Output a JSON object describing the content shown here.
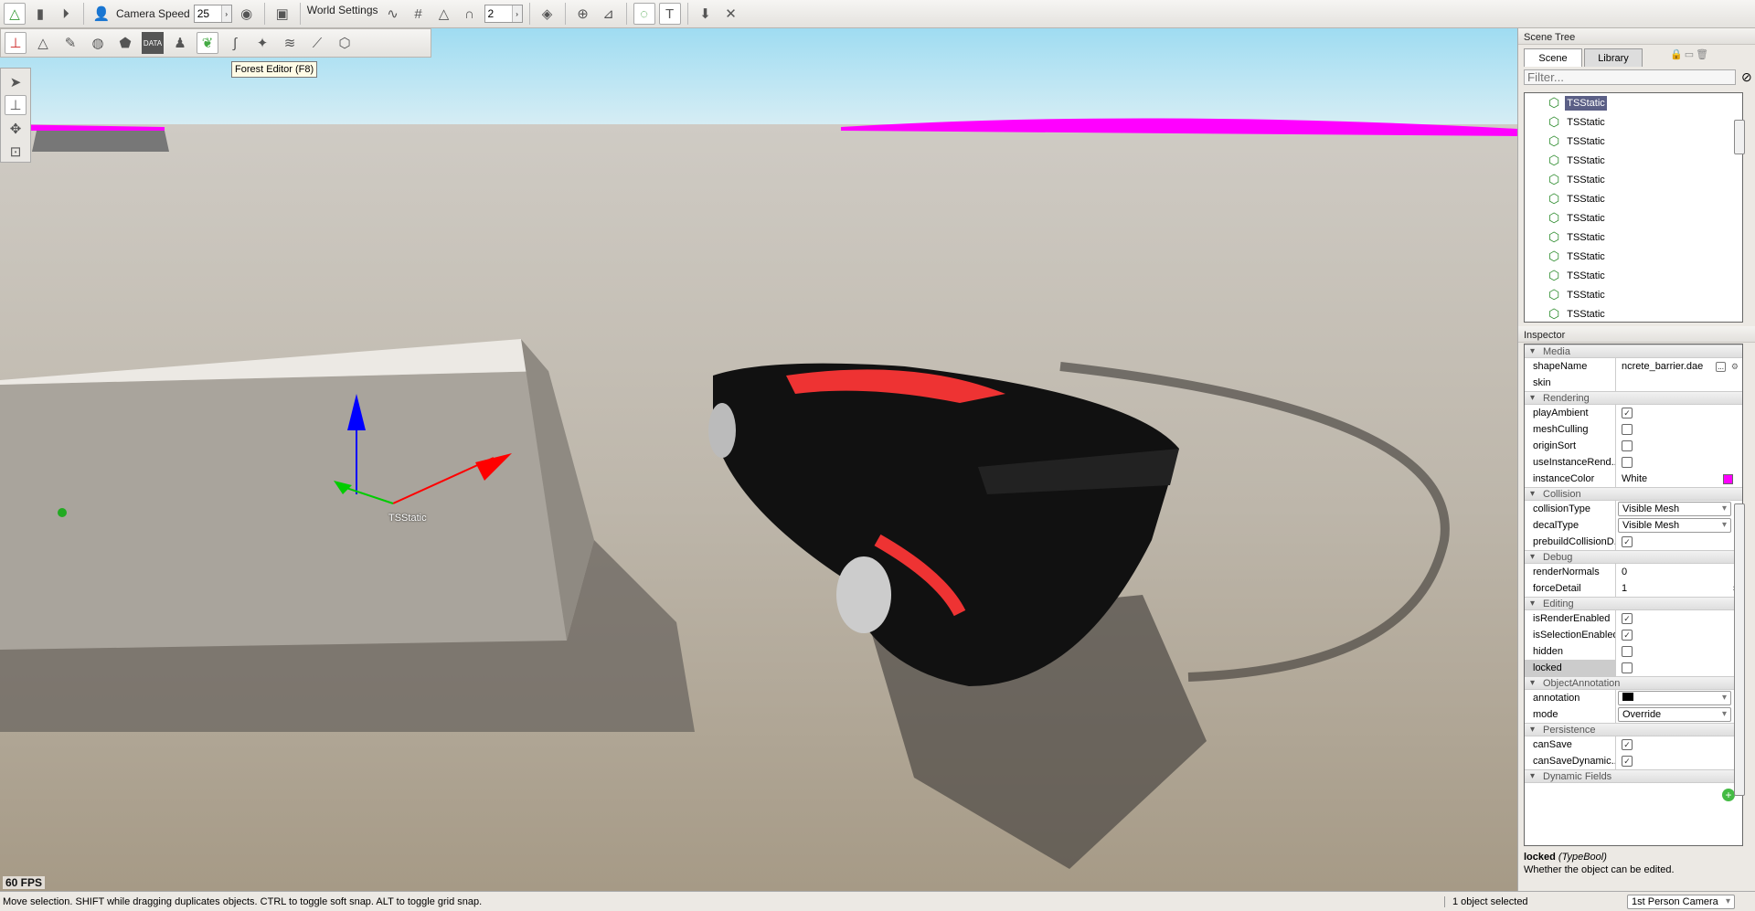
{
  "toolbar": {
    "camera_speed_label": "Camera Speed",
    "camera_speed": "25",
    "world_settings": "World Settings",
    "snap_value": "2"
  },
  "tooltip": "Forest Editor (F8)",
  "viewport": {
    "object_label": "TSStatic",
    "fps": "60 FPS"
  },
  "scene_tree": {
    "title": "Scene Tree",
    "tabs": [
      "Scene",
      "Library"
    ],
    "filter_placeholder": "Filter...",
    "items": [
      "TSStatic",
      "TSStatic",
      "TSStatic",
      "TSStatic",
      "TSStatic",
      "TSStatic",
      "TSStatic",
      "TSStatic",
      "TSStatic",
      "TSStatic",
      "TSStatic",
      "TSStatic"
    ]
  },
  "inspector": {
    "title": "Inspector",
    "sections": [
      {
        "name": "Media",
        "rows": [
          {
            "k": "shapeName",
            "v": "ncrete_barrier.dae",
            "type": "text"
          },
          {
            "k": "skin",
            "v": "",
            "type": "text"
          }
        ]
      },
      {
        "name": "Rendering",
        "rows": [
          {
            "k": "playAmbient",
            "type": "check",
            "checked": true
          },
          {
            "k": "meshCulling",
            "type": "check",
            "checked": false
          },
          {
            "k": "originSort",
            "type": "check",
            "checked": false
          },
          {
            "k": "useInstanceRend...",
            "type": "check",
            "checked": false
          },
          {
            "k": "instanceColor",
            "v": "White",
            "type": "color",
            "color": "#ff00ff"
          }
        ]
      },
      {
        "name": "Collision",
        "rows": [
          {
            "k": "collisionType",
            "v": "Visible Mesh",
            "type": "dropdown"
          },
          {
            "k": "decalType",
            "v": "Visible Mesh",
            "type": "dropdown"
          },
          {
            "k": "prebuildCollisionD...",
            "type": "check",
            "checked": true
          }
        ]
      },
      {
        "name": "Debug",
        "rows": [
          {
            "k": "renderNormals",
            "v": "0",
            "type": "text"
          },
          {
            "k": "forceDetail",
            "v": "1",
            "type": "spinner"
          }
        ]
      },
      {
        "name": "Editing",
        "rows": [
          {
            "k": "isRenderEnabled",
            "type": "check",
            "checked": true
          },
          {
            "k": "isSelectionEnabled",
            "type": "check",
            "checked": true
          },
          {
            "k": "hidden",
            "type": "check",
            "checked": false
          },
          {
            "k": "locked",
            "type": "check",
            "checked": false,
            "highlight": true
          }
        ]
      },
      {
        "name": "ObjectAnnotation",
        "rows": [
          {
            "k": "annotation",
            "v": "",
            "type": "dropdown",
            "swatch": "#000000"
          },
          {
            "k": "mode",
            "v": "Override",
            "type": "dropdown"
          }
        ]
      },
      {
        "name": "Persistence",
        "rows": [
          {
            "k": "canSave",
            "type": "check",
            "checked": true
          },
          {
            "k": "canSaveDynamic...",
            "type": "check",
            "checked": true
          }
        ]
      },
      {
        "name": "Dynamic Fields",
        "rows": []
      }
    ],
    "help_field": "locked",
    "help_type": "(TypeBool)",
    "help_text": "Whether the object can be edited."
  },
  "status": {
    "hint": "Move selection.  SHIFT while dragging duplicates objects.  CTRL to toggle soft snap.  ALT to toggle grid snap.",
    "selection": "1 object selected",
    "camera": "1st Person Camera"
  }
}
